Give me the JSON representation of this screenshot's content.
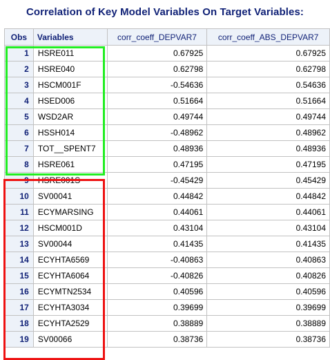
{
  "title": "Correlation of Key Model Variables On Target Variables:",
  "table": {
    "columns": [
      "Obs",
      "Variables",
      "corr_coeff_DEPVAR7",
      "corr_coeff_ABS_DEPVAR7"
    ],
    "rows": [
      {
        "obs": "1",
        "variable": "HSRE011",
        "corr": "0.67925",
        "abs": "0.67925"
      },
      {
        "obs": "2",
        "variable": "HSRE040",
        "corr": "0.62798",
        "abs": "0.62798"
      },
      {
        "obs": "3",
        "variable": "HSCM001F",
        "corr": "-0.54636",
        "abs": "0.54636"
      },
      {
        "obs": "4",
        "variable": "HSED006",
        "corr": "0.51664",
        "abs": "0.51664"
      },
      {
        "obs": "5",
        "variable": "WSD2AR",
        "corr": "0.49744",
        "abs": "0.49744"
      },
      {
        "obs": "6",
        "variable": "HSSH014",
        "corr": "-0.48962",
        "abs": "0.48962"
      },
      {
        "obs": "7",
        "variable": "TOT__SPENT7",
        "corr": "0.48936",
        "abs": "0.48936"
      },
      {
        "obs": "8",
        "variable": "HSRE061",
        "corr": "0.47195",
        "abs": "0.47195"
      },
      {
        "obs": "9",
        "variable": "HSRE001S",
        "corr": "-0.45429",
        "abs": "0.45429"
      },
      {
        "obs": "10",
        "variable": "SV00041",
        "corr": "0.44842",
        "abs": "0.44842"
      },
      {
        "obs": "11",
        "variable": "ECYMARSING",
        "corr": "0.44061",
        "abs": "0.44061"
      },
      {
        "obs": "12",
        "variable": "HSCM001D",
        "corr": "0.43104",
        "abs": "0.43104"
      },
      {
        "obs": "13",
        "variable": "SV00044",
        "corr": "0.41435",
        "abs": "0.41435"
      },
      {
        "obs": "14",
        "variable": "ECYHTA6569",
        "corr": "-0.40863",
        "abs": "0.40863"
      },
      {
        "obs": "15",
        "variable": "ECYHTA6064",
        "corr": "-0.40826",
        "abs": "0.40826"
      },
      {
        "obs": "16",
        "variable": "ECYMTN2534",
        "corr": "0.40596",
        "abs": "0.40596"
      },
      {
        "obs": "17",
        "variable": "ECYHTA3034",
        "corr": "0.39699",
        "abs": "0.39699"
      },
      {
        "obs": "18",
        "variable": "ECYHTA2529",
        "corr": "0.38889",
        "abs": "0.38889"
      },
      {
        "obs": "19",
        "variable": "SV00066",
        "corr": "0.38736",
        "abs": "0.38736"
      }
    ]
  },
  "colors": {
    "header_text": "#112277",
    "header_bg": "#edf2f9",
    "grid": "#c1c1c1",
    "highlight_green": "#22ee22",
    "highlight_red": "#ee1111"
  }
}
